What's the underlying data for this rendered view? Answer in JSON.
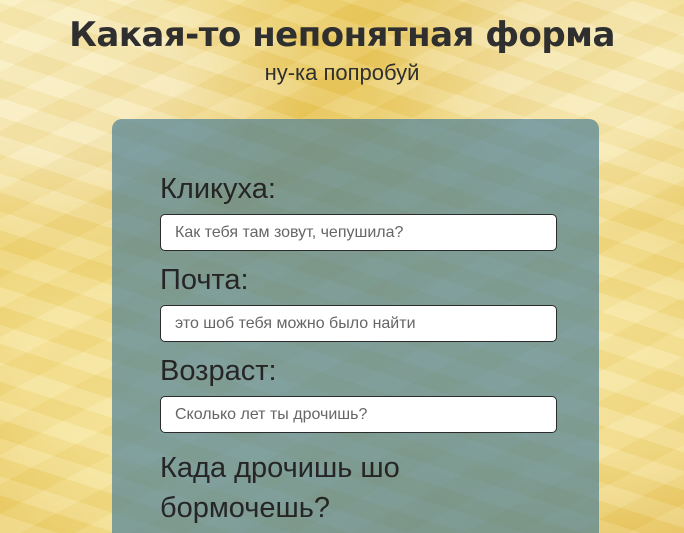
{
  "header": {
    "title": "Какая-то непонятная форма",
    "subtitle": "ну-ка попробуй"
  },
  "form": {
    "fields": [
      {
        "label": "Кликуха:",
        "placeholder": "Как тебя там зовут, чепушила?"
      },
      {
        "label": "Почта:",
        "placeholder": "это шоб тебя можно было найти"
      },
      {
        "label": "Возраст:",
        "placeholder": "Сколько лет ты дрочишь?"
      },
      {
        "label": "Када дрочишь шо бормочешь?"
      }
    ]
  },
  "colors": {
    "text": "#2f2f2f",
    "card": "#487e96",
    "background": "#f1d978",
    "input_border": "#2b2b2b",
    "input_background": "#ffffff"
  }
}
